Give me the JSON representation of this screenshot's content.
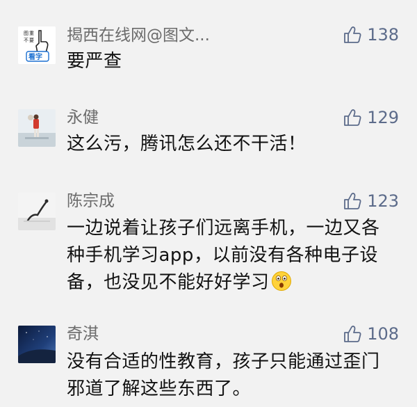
{
  "comments": [
    {
      "name": "揭西在线网@图文...",
      "likes": "138",
      "lines": [
        "要严查"
      ],
      "avatar_text": "看字"
    },
    {
      "name": "永健",
      "likes": "129",
      "lines": [
        "这么污，腾讯怎么还不干活！"
      ]
    },
    {
      "name": "陈宗成",
      "likes": "123",
      "lines": [
        "一边说着让孩子们远离手机，一边又各",
        "种手机学习app，以前没有各种电子设",
        "备，也没见不能好好学习"
      ]
    },
    {
      "name": "奇淇",
      "likes": "108",
      "lines": [
        "没有合适的性教育，孩子只能通过歪门",
        "邪道了解这些东西了。"
      ]
    }
  ],
  "icons": {
    "like": "thumbs-up-icon",
    "emoji": "astonished-face-emoji"
  },
  "colors": {
    "background": "#f2f2f2",
    "name": "#6b6b6b",
    "likes": "#5c6b8a",
    "text": "#111111"
  }
}
